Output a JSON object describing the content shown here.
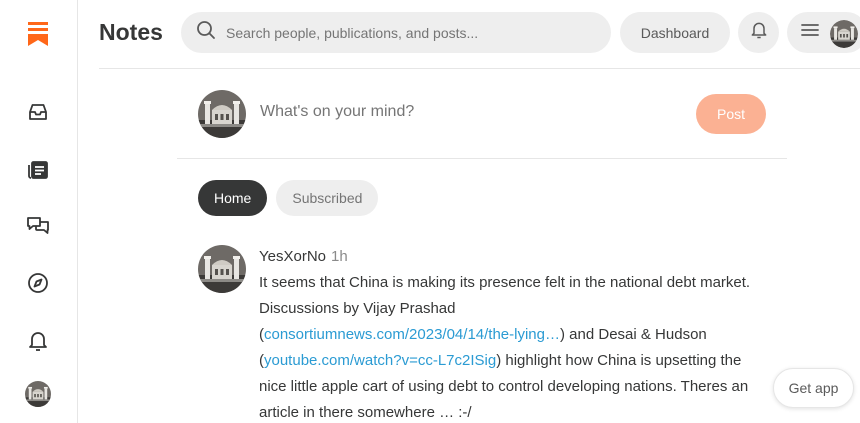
{
  "colors": {
    "brand": "#ff6719",
    "post_button": "#fbb193",
    "link": "#2b9bd3",
    "active_tab": "#363737",
    "pill_bg": "#eeeeee"
  },
  "sidebar": {
    "items": [
      {
        "name": "substack-logo-icon"
      },
      {
        "name": "inbox-icon"
      },
      {
        "name": "reader-icon"
      },
      {
        "name": "chat-icon"
      },
      {
        "name": "explore-icon"
      },
      {
        "name": "notifications-bell-icon"
      },
      {
        "name": "profile-avatar"
      }
    ]
  },
  "header": {
    "title": "Notes",
    "search": {
      "placeholder": "Search people, publications, and posts...",
      "value": ""
    },
    "dashboard_label": "Dashboard"
  },
  "composer": {
    "placeholder": "What's on your mind?",
    "post_label": "Post"
  },
  "tabs": [
    {
      "label": "Home",
      "active": true
    },
    {
      "label": "Subscribed",
      "active": false
    }
  ],
  "note": {
    "author": "YesXorNo",
    "time": "1h",
    "text_1": "It seems that China is making its presence felt in the national debt market.  Discussions by Vijay Prashad",
    "paren_open_1": "(",
    "link_1": "consortiumnews.com/2023/04/14/the-lying…",
    "text_2": ") and Desai & Hudson",
    "paren_open_2": "(",
    "link_2": "youtube.com/watch?v=cc-L7c2ISig",
    "text_3": ") highlight how China is upsetting the nice little apple cart of using debt to control developing nations.  Theres an article in there somewhere … :-/"
  },
  "get_app_label": "Get app"
}
